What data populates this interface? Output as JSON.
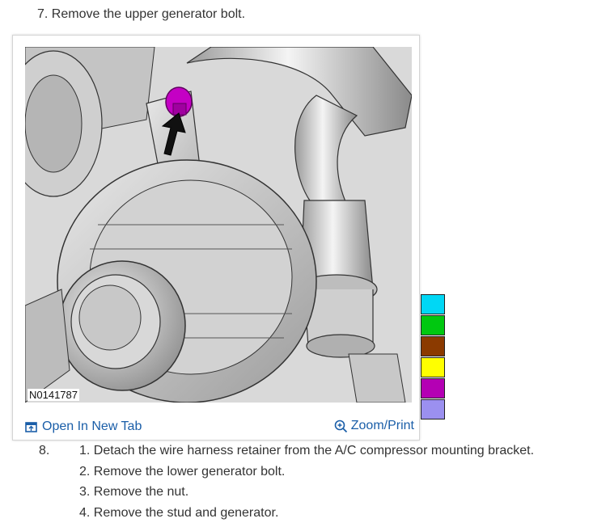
{
  "step7": {
    "title": "7. Remove the upper generator bolt."
  },
  "figure": {
    "image_id": "N0141787",
    "open_tab_label": "Open In New Tab",
    "zoom_label": "Zoom/Print"
  },
  "color_swatches": [
    "#00D7F5",
    "#00C810",
    "#8B3A00",
    "#FFFF00",
    "#B400B4",
    "#9B90F0"
  ],
  "step8": {
    "number": "8.",
    "items": [
      "1. Detach the wire harness retainer from the A/C compressor mounting bracket.",
      "2. Remove the lower generator bolt.",
      "3. Remove the nut.",
      "4. Remove the stud and generator."
    ]
  }
}
